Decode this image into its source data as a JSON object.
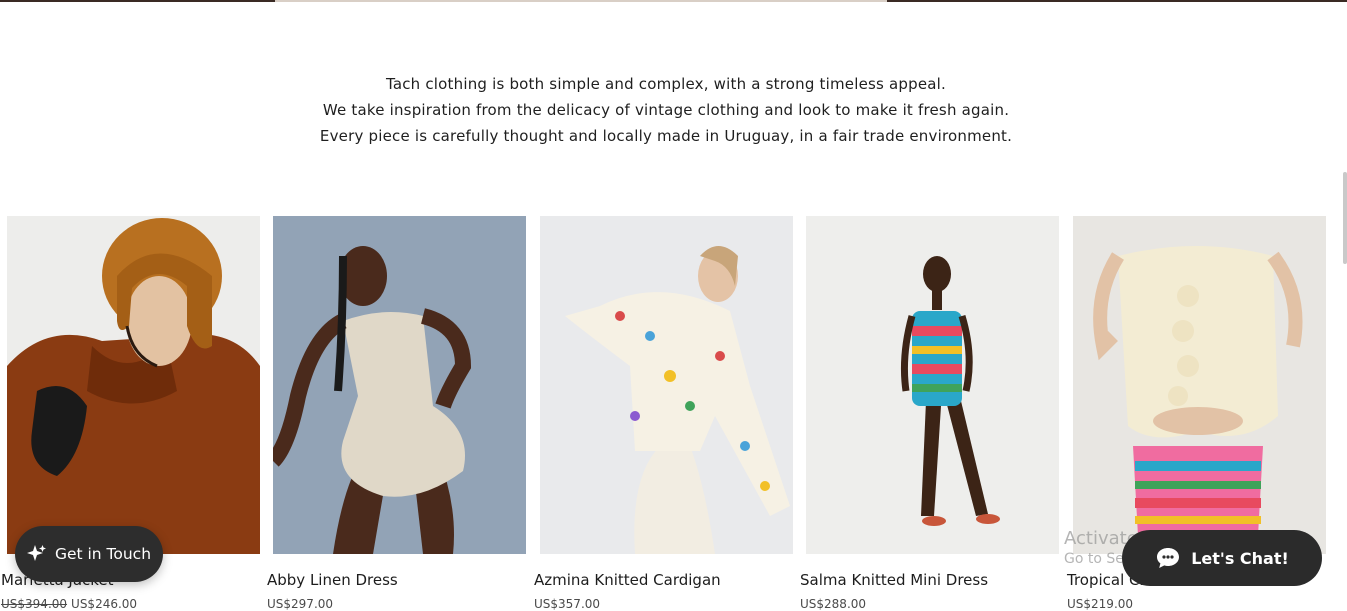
{
  "intro": {
    "lines": [
      "Tach clothing is both simple and complex, with a strong timeless appeal.",
      "We take inspiration from the delicacy of vintage clothing and look to make it fresh again.",
      "Every piece is carefully thought and locally made in Uruguay, in a fair trade environment."
    ]
  },
  "products": [
    {
      "name": "Marietta Jacket",
      "old_price": "US$394.00",
      "price": "US$246.00"
    },
    {
      "name": "Abby Linen Dress",
      "old_price": "",
      "price": "US$297.00"
    },
    {
      "name": "Azmina Knitted Cardigan",
      "old_price": "",
      "price": "US$357.00"
    },
    {
      "name": "Salma Knitted Mini Dress",
      "old_price": "",
      "price": "US$288.00"
    },
    {
      "name": "Tropical Crochet",
      "old_price": "",
      "price": "US$219.00"
    }
  ],
  "get_in_touch": {
    "label": "Get in Touch"
  },
  "chat": {
    "label": "Let's Chat!"
  },
  "watermark": {
    "title": "Activate Windows",
    "subtitle": "Go to Settings to activate Windows."
  },
  "colors": {
    "button_bg": "#2d2d2d",
    "accent_rust": "#8a3b12",
    "text": "#1f1f1f"
  }
}
